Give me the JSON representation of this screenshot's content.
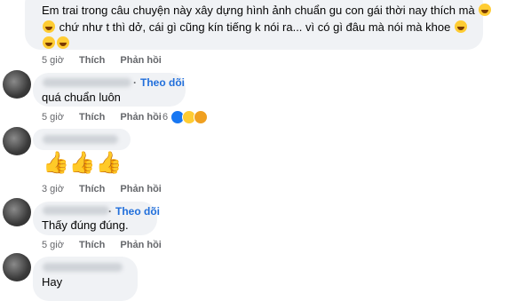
{
  "comments": [
    {
      "line1": "Em trai trong câu chuyện này xây dựng hình ảnh chuẩn gu con gái thời nay thích mà",
      "line2": "chứ như t thì dở, cái gì cũng kín tiếng k nói ra... vì có gì đâu mà nói mà khoe",
      "time": "5 giờ",
      "like": "Thích",
      "reply": "Phản hồi"
    },
    {
      "follow": "Theo dõi",
      "text": "quá chuẩn luôn",
      "time": "5 giờ",
      "like": "Thích",
      "reply": "Phản hồi",
      "reaction_count": "6"
    },
    {
      "text": "👍👍👍",
      "time": "3 giờ",
      "like": "Thích",
      "reply": "Phản hồi"
    },
    {
      "follow": "Theo dõi",
      "text": "Thấy đúng đúng.",
      "time": "5 giờ",
      "like": "Thích",
      "reply": "Phản hồi"
    },
    {
      "text": "Hay"
    }
  ],
  "icons": {
    "emoji": "grinning-sweat-emoji",
    "thumb": "thumbs-up-emoji",
    "reactions": [
      "like-reaction",
      "haha-reaction",
      "care-reaction"
    ]
  },
  "colors": {
    "bubble": "#f0f2f5",
    "link": "#216fdb",
    "meta": "#65676b",
    "text": "#050505"
  }
}
